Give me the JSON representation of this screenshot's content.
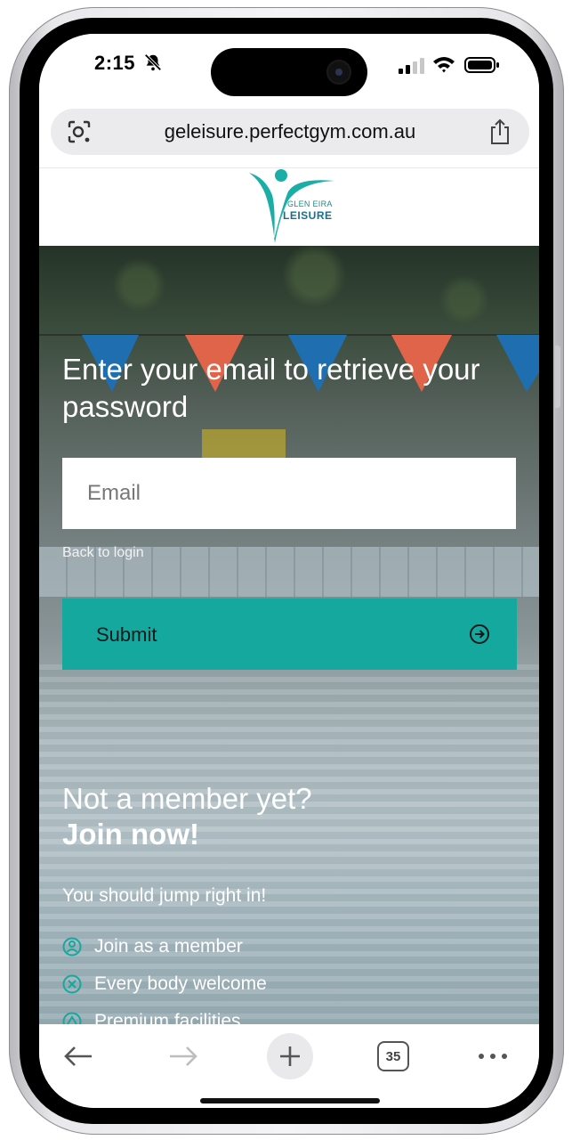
{
  "status_bar": {
    "time": "2:15",
    "icons": [
      "bell-slash-icon",
      "signal-icon",
      "wifi-icon",
      "battery-icon"
    ]
  },
  "browser": {
    "url": "geleisure.perfectgym.com.au",
    "icons": [
      "camera-search-icon",
      "share-icon"
    ]
  },
  "site": {
    "logo": {
      "small_text": "GLEN EIRA",
      "big_text": "LEISURE"
    },
    "brand_color": "#14a89f"
  },
  "form": {
    "title": "Enter your email to retrieve your password",
    "email_placeholder": "Email",
    "email_value": "",
    "back_link": "Back to login",
    "submit_label": "Submit",
    "submit_icon": "arrow-right-circle-icon"
  },
  "join": {
    "question": "Not a member yet?",
    "cta": "Join now!",
    "tagline": "You should jump right in!",
    "benefits": [
      {
        "label": "Join as a member",
        "icon": "member-icon"
      },
      {
        "label": "Every body welcome",
        "icon": "welcome-icon"
      },
      {
        "label": "Premium facilities",
        "icon": "facilities-icon"
      }
    ]
  },
  "toolbar": {
    "tabs_count": "35",
    "icons": [
      "back-arrow-icon",
      "forward-arrow-icon",
      "plus-icon",
      "more-icon"
    ]
  }
}
